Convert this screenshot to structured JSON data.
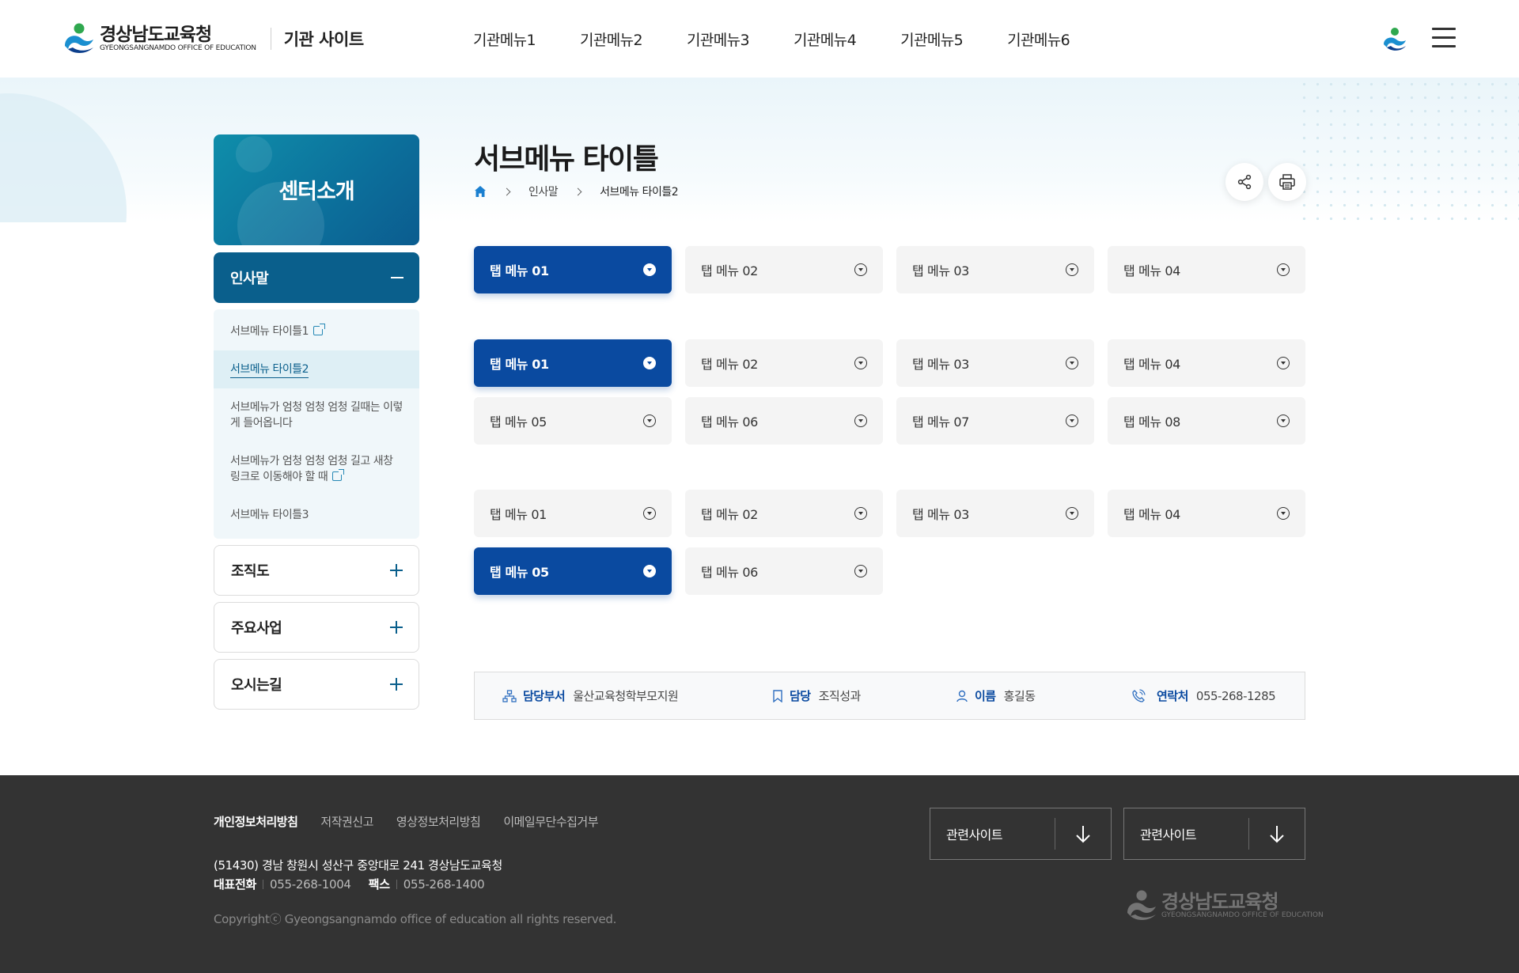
{
  "header": {
    "logo_kr": "경상남도교육청",
    "logo_en": "GYEONGSANGNAMDO OFFICE OF EDUCATION",
    "site_name": "기관 사이트",
    "gnb": [
      "기관메뉴1",
      "기관메뉴2",
      "기관메뉴3",
      "기관메뉴4",
      "기관메뉴5",
      "기관메뉴6"
    ]
  },
  "lnb": {
    "title": "센터소개",
    "active": "인사말",
    "sub_items": [
      {
        "label": "서브메뉴 타이틀1",
        "external": true
      },
      {
        "label": "서브메뉴 타이틀2",
        "current": true
      },
      {
        "label": "서브메뉴가 엄청 엄청 엄청 길때는 이렇게 들어옵니다"
      },
      {
        "label": "서브메뉴가 엄청 엄청 엄청 길고 새창 링크로 이동해야 할 때",
        "external": true
      },
      {
        "label": "서브메뉴 타이틀3"
      }
    ],
    "collapsed": [
      "조직도",
      "주요사업",
      "오시는길"
    ]
  },
  "content": {
    "page_title": "서브메뉴 타이틀",
    "breadcrumb": [
      "인사말",
      "서브메뉴 타이틀2"
    ],
    "tab_group1": [
      "탭 메뉴 01",
      "탭 메뉴 02",
      "탭 메뉴 03",
      "탭 메뉴 04"
    ],
    "tab_group2": [
      "탭 메뉴 01",
      "탭 메뉴 02",
      "탭 메뉴 03",
      "탭 메뉴 04",
      "탭 메뉴 05",
      "탭 메뉴 06",
      "탭 메뉴 07",
      "탭 메뉴 08"
    ],
    "tab_group3": [
      "탭 메뉴 01",
      "탭 메뉴 02",
      "탭 메뉴 03",
      "탭 메뉴 04",
      "탭 메뉴 05",
      "탭 메뉴 06"
    ],
    "info": {
      "dept_label": "담당부서",
      "dept_value": "울산교육청학부모지원",
      "charge_label": "담당",
      "charge_value": "조직성과",
      "name_label": "이름",
      "name_value": "홍길동",
      "contact_label": "연락처",
      "contact_value": "055-268-1285"
    }
  },
  "footer": {
    "links": [
      "개인정보처리방침",
      "저작권신고",
      "영상정보처리방침",
      "이메일무단수집거부"
    ],
    "address": "(51430) 경남 창원시 성산구 중앙대로 241 경상남도교육청",
    "tel_label": "대표전화",
    "tel": "055-268-1004",
    "fax_label": "팩스",
    "fax": "055-268-1400",
    "copyright": "Copyrightⓒ Gyeongsangnamdo office of education all rights reserved.",
    "related1": "관련사이트",
    "related2": "관련사이트",
    "logo_kr": "경상남도교육청",
    "logo_en": "GYEONGSANGNAMDO OFFICE OF EDUCATION"
  },
  "colors": {
    "primary_blue": "#0a4aa0",
    "teal": "#0a5f8c",
    "footer_bg": "#333333"
  }
}
